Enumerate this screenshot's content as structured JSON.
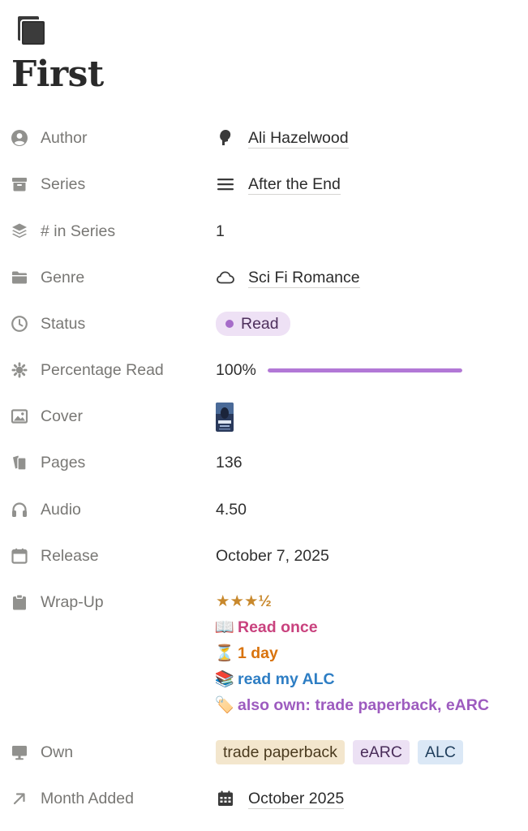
{
  "page": {
    "icon": "book-stack-icon",
    "title": "First"
  },
  "properties": {
    "author": {
      "label": "Author",
      "icon": "user-circle-icon",
      "value": "Ali Hazelwood",
      "value_icon": "person-head-icon"
    },
    "series": {
      "label": "Series",
      "icon": "archive-box-icon",
      "value": "After the End",
      "value_icon": "lines-menu-icon"
    },
    "in_series": {
      "label": "# in Series",
      "icon": "layers-icon",
      "value": "1"
    },
    "genre": {
      "label": "Genre",
      "icon": "folder-icon",
      "value": "Sci Fi Romance",
      "value_icon": "cloud-icon"
    },
    "status": {
      "label": "Status",
      "icon": "clock-icon",
      "value": "Read",
      "color": "#a66cc9"
    },
    "percentage_read": {
      "label": "Percentage Read",
      "icon": "sparkle-gear-icon",
      "value": "100%",
      "progress": 1.0,
      "bar_color": "#b278d6"
    },
    "cover": {
      "label": "Cover",
      "icon": "image-icon",
      "value_icon": "book-cover-thumbnail"
    },
    "pages": {
      "label": "Pages",
      "icon": "pages-icon",
      "value": "136"
    },
    "audio": {
      "label": "Audio",
      "icon": "headphones-icon",
      "value": "4.50"
    },
    "release": {
      "label": "Release",
      "icon": "calendar-icon",
      "value": "October 7, 2025"
    },
    "wrap_up": {
      "label": "Wrap-Up",
      "icon": "clipboard-icon",
      "lines": [
        {
          "emoji": "",
          "text": "★★★½",
          "color": "#c8882c"
        },
        {
          "emoji": "📖",
          "text": "Read once",
          "color": "#c9427e"
        },
        {
          "emoji": "⏳",
          "text": "1 day",
          "color": "#d9730d"
        },
        {
          "emoji": "📚",
          "text": "read my ALC",
          "color": "#2e7ec4"
        },
        {
          "emoji": "🏷️",
          "text": "also own: trade paperback, eARC",
          "color": "#9d5bbf"
        }
      ]
    },
    "own": {
      "label": "Own",
      "icon": "monitor-icon",
      "tags": [
        {
          "text": "trade paperback",
          "bg": "#f3e6cd",
          "fg": "#4a3a1e"
        },
        {
          "text": "eARC",
          "bg": "#ece1f4",
          "fg": "#4a2d5a"
        },
        {
          "text": "ALC",
          "bg": "#dbe8f6",
          "fg": "#1f3e5c"
        }
      ]
    },
    "month_added": {
      "label": "Month Added",
      "icon": "arrow-up-right-icon",
      "value": "October 2025",
      "value_icon": "calendar-grid-icon"
    }
  }
}
